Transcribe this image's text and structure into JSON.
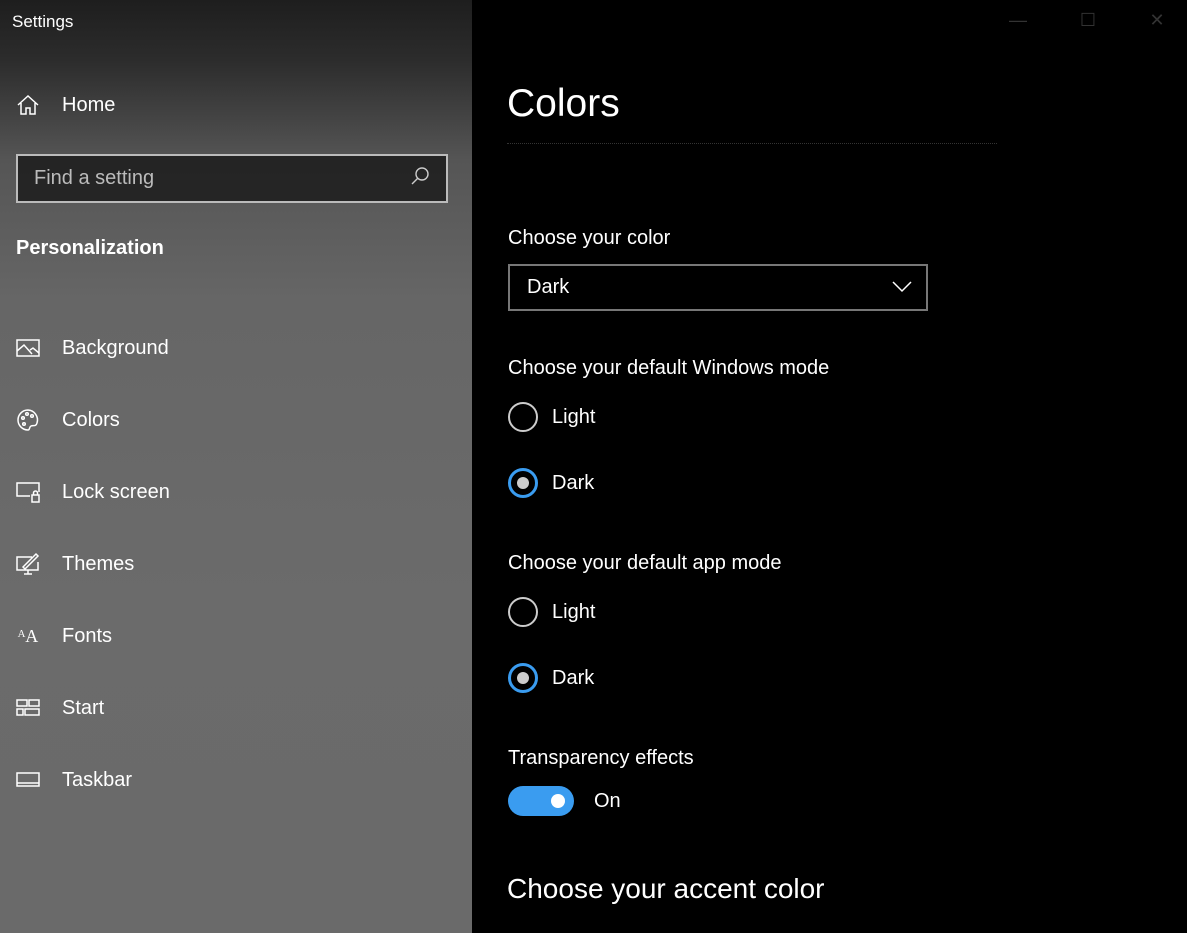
{
  "window": {
    "title": "Settings"
  },
  "sidebar": {
    "home": "Home",
    "search_placeholder": "Find a setting",
    "section": "Personalization",
    "items": [
      {
        "label": "Background",
        "icon": "image-icon"
      },
      {
        "label": "Colors",
        "icon": "palette-icon"
      },
      {
        "label": "Lock screen",
        "icon": "lock-screen-icon"
      },
      {
        "label": "Themes",
        "icon": "themes-icon"
      },
      {
        "label": "Fonts",
        "icon": "fonts-icon"
      },
      {
        "label": "Start",
        "icon": "start-icon"
      },
      {
        "label": "Taskbar",
        "icon": "taskbar-icon"
      }
    ]
  },
  "main": {
    "title": "Colors",
    "choose_color_label": "Choose your color",
    "choose_color_value": "Dark",
    "windows_mode_label": "Choose your default Windows mode",
    "windows_mode_options": [
      "Light",
      "Dark"
    ],
    "windows_mode_selected": "Dark",
    "app_mode_label": "Choose your default app mode",
    "app_mode_options": [
      "Light",
      "Dark"
    ],
    "app_mode_selected": "Dark",
    "transparency_label": "Transparency effects",
    "transparency_state": "On",
    "accent_heading": "Choose your accent color"
  },
  "colors": {
    "accent": "#3a9cf0"
  }
}
